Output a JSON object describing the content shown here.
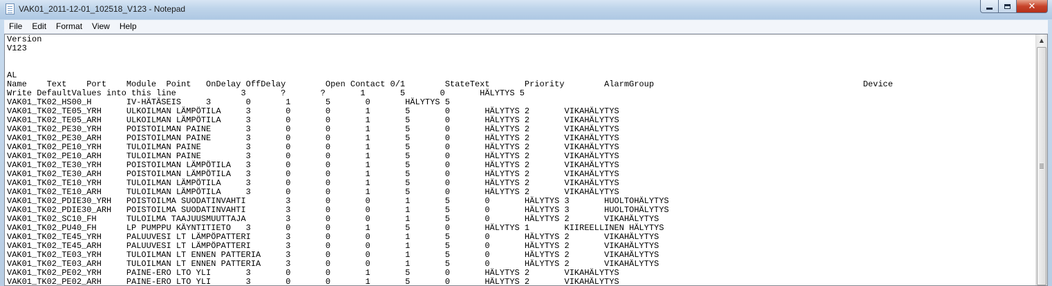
{
  "window": {
    "title": "VAK01_2011-12-01_102518_V123 - Notepad",
    "close_glyph": "✕"
  },
  "menu": {
    "items": [
      "File",
      "Edit",
      "Format",
      "View",
      "Help"
    ]
  },
  "document": {
    "lines": [
      "Version",
      "V123",
      "",
      "",
      "AL",
      "Name    Text    Port    Module  Point   OnDelay OffDelay        Open Contact 0/1        StateText       Priority        AlarmGroup                                          Device",
      "Write DefaultValues into this line             3       ?       ?       1       5       0       HÄLYTYS 5",
      "VAK01_TK02_HS00_H       IV-HÄTÄSEIS     3       0       1       5       0       HÄLYTYS 5",
      "VAK01_TK02_TE05_YRH     ULKOILMAN LÄMPÖTILA     3       0       0       1       5       0       HÄLYTYS 2       VIKAHÄLYTYS",
      "VAK01_TK02_TE05_ARH     ULKOILMAN LÄMPÖTILA     3       0       0       1       5       0       HÄLYTYS 2       VIKAHÄLYTYS",
      "VAK01_TK02_PE30_YRH     POISTOILMAN PAINE       3       0       0       1       5       0       HÄLYTYS 2       VIKAHÄLYTYS",
      "VAK01_TK02_PE30_ARH     POISTOILMAN PAINE       3       0       0       1       5       0       HÄLYTYS 2       VIKAHÄLYTYS",
      "VAK01_TK02_PE10_YRH     TULOILMAN PAINE         3       0       0       1       5       0       HÄLYTYS 2       VIKAHÄLYTYS",
      "VAK01_TK02_PE10_ARH     TULOILMAN PAINE         3       0       0       1       5       0       HÄLYTYS 2       VIKAHÄLYTYS",
      "VAK01_TK02_TE30_YRH     POISTOILMAN LÄMPÖTILA   3       0       0       1       5       0       HÄLYTYS 2       VIKAHÄLYTYS",
      "VAK01_TK02_TE30_ARH     POISTOILMAN LÄMPÖTILA   3       0       0       1       5       0       HÄLYTYS 2       VIKAHÄLYTYS",
      "VAK01_TK02_TE10_YRH     TULOILMAN LÄMPÖTILA     3       0       0       1       5       0       HÄLYTYS 2       VIKAHÄLYTYS",
      "VAK01_TK02_TE10_ARH     TULOILMAN LÄMPÖTILA     3       0       0       1       5       0       HÄLYTYS 2       VIKAHÄLYTYS",
      "VAK01_TK02_PDIE30_YRH   POISTOILMA SUODATINVAHTI        3       0       0       1       5       0       HÄLYTYS 3       HUOLTOHÄLYTYS",
      "VAK01_TK02_PDIE30_ARH   POISTOILMA SUODATINVAHTI        3       0       0       1       5       0       HÄLYTYS 3       HUOLTOHÄLYTYS",
      "VAK01_TK02_SC10_FH      TULOILMA TAAJUUSMUUTTAJA        3       0       0       1       5       0       HÄLYTYS 2       VIKAHÄLYTYS",
      "VAK01_TK02_PU40_FH      LP PUMPPU KÄYNTITIETO   3       0       0       1       5       0       HÄLYTYS 1       KIIREELLINEN HÄLYTYS",
      "VAK01_TK02_TE45_YRH     PALUUVESI LT LÄMPÖPATTERI       3       0       0       1       5       0       HÄLYTYS 2       VIKAHÄLYTYS",
      "VAK01_TK02_TE45_ARH     PALUUVESI LT LÄMPÖPATTERI       3       0       0       1       5       0       HÄLYTYS 2       VIKAHÄLYTYS",
      "VAK01_TK02_TE03_YRH     TULOILMAN LT ENNEN PATTERIA     3       0       0       1       5       0       HÄLYTYS 2       VIKAHÄLYTYS",
      "VAK01_TK02_TE03_ARH     TULOILMAN LT ENNEN PATTERIA     3       0       0       1       5       0       HÄLYTYS 2       VIKAHÄLYTYS",
      "VAK01_TK02_PE02_YRH     PAINE-ERO LTO YLI       3       0       0       1       5       0       HÄLYTYS 2       VIKAHÄLYTYS",
      "VAK01_TK02_PE02_ARH     PAINE-ERO LTO YLI       3       0       0       1       5       0       HÄLYTYS 2       VIKAHÄLYTYS"
    ]
  },
  "scrollbar": {
    "up_glyph": "▲",
    "grip_icon": "grip-lines"
  }
}
